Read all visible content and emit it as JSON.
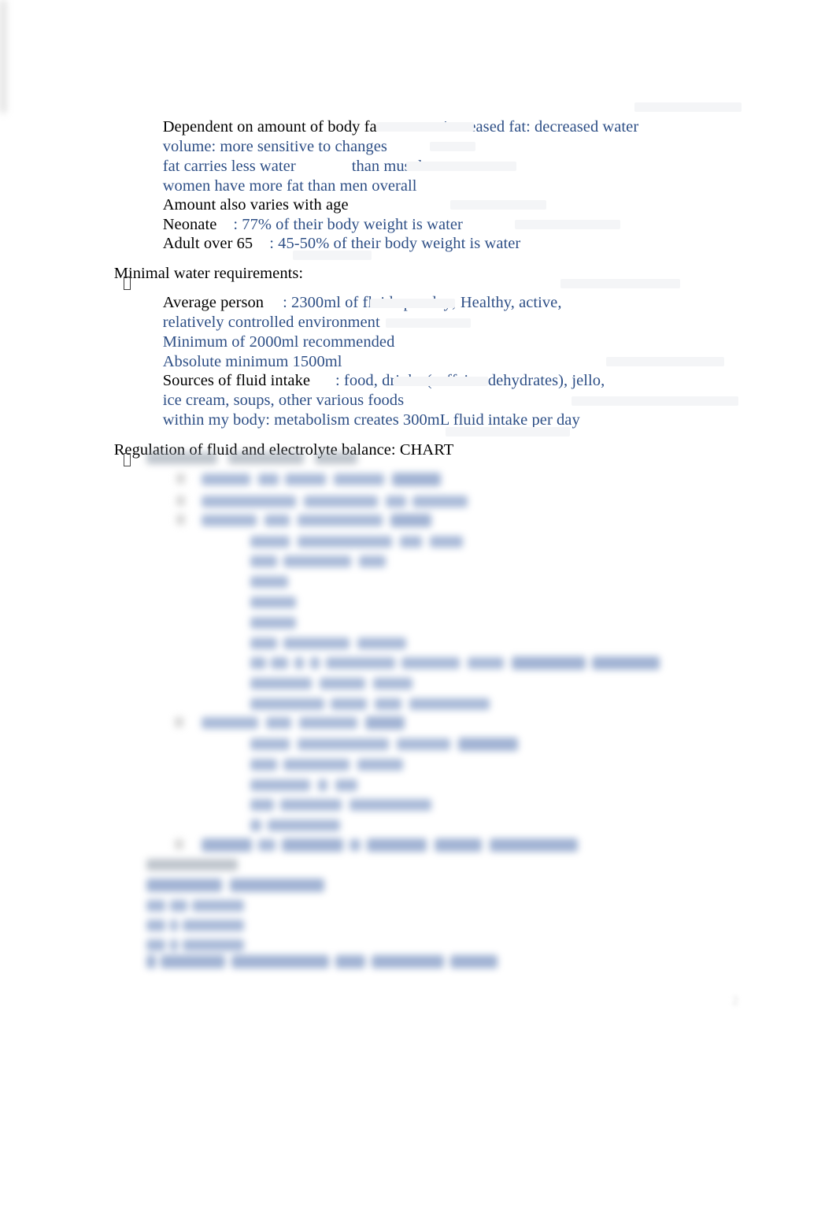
{
  "document": {
    "type": "study-notes",
    "colors": {
      "body_text": "#000000",
      "annotation_text": "#2e4f86",
      "page_background": "#ffffff"
    },
    "page_number": "2"
  },
  "sections": [
    {
      "id": "body-fat",
      "lines": [
        {
          "indent": 1,
          "bullet": "",
          "runs": [
            {
              "text": "Dependent on amount of body fat",
              "color": "black"
            },
            {
              "text": "\t\t",
              "color": "black"
            },
            {
              "text": ": increased fat: decreased water",
              "color": "blue"
            }
          ]
        },
        {
          "indent": 1,
          "bullet": "",
          "runs": [
            {
              "text": "volume: more sensitive to changes",
              "color": "blue"
            }
          ]
        },
        {
          "indent": 1,
          "bullet": "",
          "runs": [
            {
              "text": "fat carries less water",
              "color": "blue"
            },
            {
              "text": "\t\t",
              "color": "blue"
            },
            {
              "text": "than muscle",
              "color": "blue"
            }
          ]
        },
        {
          "indent": 1,
          "bullet": "",
          "runs": [
            {
              "text": "women have more fat than men overall",
              "color": "blue"
            }
          ]
        },
        {
          "indent": 1,
          "bullet": "",
          "runs": [
            {
              "text": "Amount also varies with age",
              "color": "black"
            }
          ]
        },
        {
          "indent": 1,
          "bullet": "",
          "runs": [
            {
              "text": "Neonate",
              "color": "black"
            },
            {
              "text": "\t",
              "color": "black"
            },
            {
              "text": ": 77% of their body weight is water",
              "color": "blue"
            }
          ]
        },
        {
          "indent": 1,
          "bullet": "",
          "runs": [
            {
              "text": "Adult over 65",
              "color": "black"
            },
            {
              "text": "\t",
              "color": "black"
            },
            {
              "text": ": 45-50% of their body weight is water",
              "color": "blue"
            }
          ]
        }
      ]
    },
    {
      "id": "minimal-water",
      "heading": "Minimal water requirements:",
      "lines": [
        {
          "indent": 1,
          "bullet": "tofu",
          "runs": [
            {
              "text": "Average person",
              "color": "black"
            },
            {
              "text": "\t",
              "color": "black"
            },
            {
              "text": ": 2300ml of fluids per day; Healthy, active,",
              "color": "blue"
            }
          ]
        },
        {
          "indent": 1,
          "bullet": "",
          "runs": [
            {
              "text": "relatively controlled environment",
              "color": "blue"
            }
          ]
        },
        {
          "indent": 1,
          "bullet": "",
          "runs": [
            {
              "text": "Minimum of 2000ml recommended",
              "color": "blue"
            }
          ]
        },
        {
          "indent": 1,
          "bullet": "",
          "runs": [
            {
              "text": "Absolute minimum 1500ml",
              "color": "blue"
            }
          ]
        },
        {
          "indent": 1,
          "bullet": "",
          "runs": [
            {
              "text": "Sources of fluid intake",
              "color": "black"
            },
            {
              "text": "\t",
              "color": "black"
            },
            {
              "text": ": food, drinks (caffeine dehydrates), jello,",
              "color": "blue"
            }
          ]
        },
        {
          "indent": 1,
          "bullet": "",
          "runs": [
            {
              "text": "ice cream, soups, other various foods",
              "color": "blue"
            }
          ]
        },
        {
          "indent": 1,
          "bullet": "",
          "runs": [
            {
              "text": "within my body: metabolism creates 300mL fluid intake per day",
              "color": "blue"
            }
          ]
        }
      ]
    },
    {
      "id": "regulation",
      "heading": "Regulation of fluid and electrolyte balance: CHART",
      "obscured": true,
      "obscured_note": "content below this heading is blurred and illegible in the source image"
    }
  ]
}
